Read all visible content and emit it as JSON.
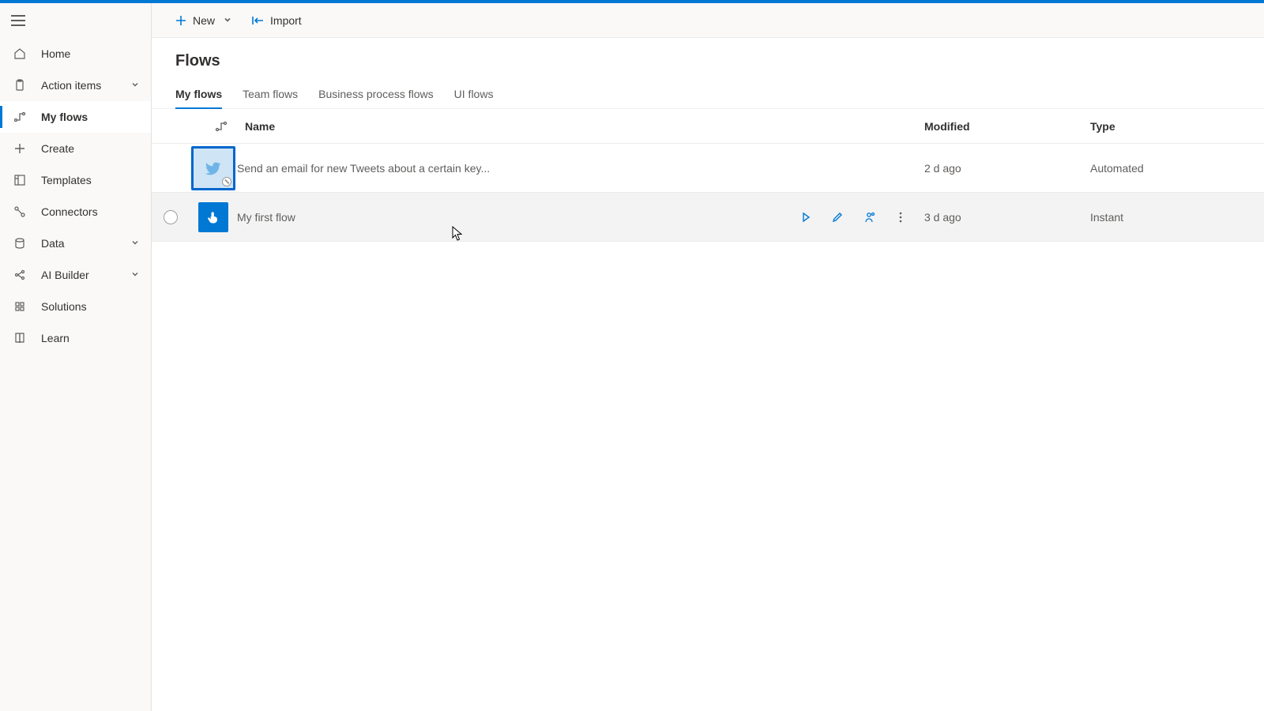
{
  "commandBar": {
    "new_label": "New",
    "import_label": "Import"
  },
  "sidebar": {
    "items": [
      {
        "label": "Home"
      },
      {
        "label": "Action items"
      },
      {
        "label": "My flows"
      },
      {
        "label": "Create"
      },
      {
        "label": "Templates"
      },
      {
        "label": "Connectors"
      },
      {
        "label": "Data"
      },
      {
        "label": "AI Builder"
      },
      {
        "label": "Solutions"
      },
      {
        "label": "Learn"
      }
    ]
  },
  "page": {
    "title": "Flows"
  },
  "tabs": {
    "my_flows": "My flows",
    "team_flows": "Team flows",
    "business_process_flows": "Business process flows",
    "ui_flows": "UI flows"
  },
  "table": {
    "headers": {
      "name": "Name",
      "modified": "Modified",
      "type": "Type"
    },
    "rows": [
      {
        "name": "Send an email for new Tweets about a certain key...",
        "modified": "2 d ago",
        "type": "Automated"
      },
      {
        "name": "My first flow",
        "modified": "3 d ago",
        "type": "Instant"
      }
    ]
  }
}
